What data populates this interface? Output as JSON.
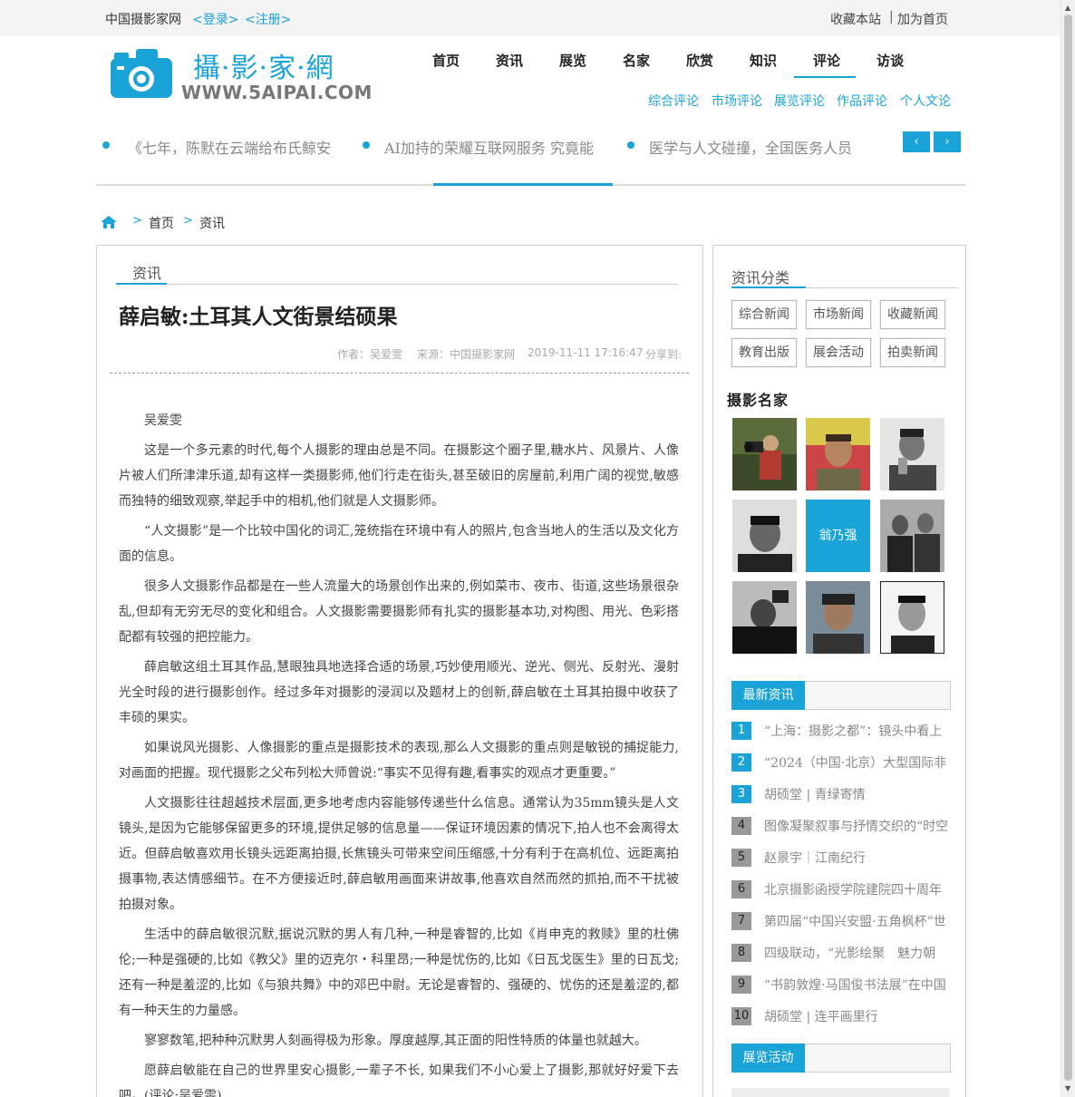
{
  "topbar": {
    "site_name": "中国摄影家网",
    "login": "<登录>",
    "register": "<注册>",
    "bookmark": "收藏本站",
    "separator": "|",
    "set_home": "加为首页"
  },
  "logo": {
    "title": "攝·影·家·網",
    "url": "WWW.5AIPAI.COM",
    "icon": "camera-icon"
  },
  "nav": {
    "items": [
      "首页",
      "资讯",
      "展览",
      "名家",
      "欣赏",
      "知识",
      "评论",
      "访谈"
    ],
    "active": "评论",
    "subnav": [
      "综合评论",
      "市场评论",
      "展览评论",
      "作品评论",
      "个人文论"
    ]
  },
  "ticker": {
    "items": [
      "《七年，陈默在云端给布氏鲸安",
      "AI加持的荣耀互联网服务 究竟能",
      "医学与人文碰撞，全国医务人员"
    ],
    "prev": "‹",
    "next": "›"
  },
  "breadcrumb": {
    "icon": "home-icon",
    "arrow": ">",
    "items": [
      "首页",
      "资讯"
    ]
  },
  "article": {
    "section": "资讯",
    "title": "薛启敏:土耳其人文街景结硕果",
    "author": "作者：吴爱雯",
    "source": "来源：中国摄影家网",
    "date": "2019-11-11 17:16:47",
    "share": "分享到:",
    "paragraphs": [
      "吴爱雯",
      "这是一个多元素的时代,每个人摄影的理由总是不同。在摄影这个圈子里,糖水片、风景片、人像片被人们所津津乐道,却有这样一类摄影师,他们行走在街头,甚至破旧的房屋前,利用广阔的视觉,敏感而独特的细致观察,举起手中的相机,他们就是人文摄影师。",
      "“人文摄影”是一个比较中国化的词汇,笼统指在环境中有人的照片,包含当地人的生活以及文化方面的信息。",
      "很多人文摄影作品都是在一些人流量大的场景创作出来的,例如菜市、夜市、街道,这些场景很杂乱,但却有无穷无尽的变化和组合。人文摄影需要摄影师有扎实的摄影基本功,对构图、用光、色彩搭配都有较强的把控能力。",
      "薛启敏这组土耳其作品,慧眼独具地选择合适的场景,巧妙使用顺光、逆光、侧光、反射光、漫射光全时段的进行摄影创作。经过多年对摄影的浸润以及题材上的创新,薛启敏在土耳其拍摄中收获了丰硕的果实。",
      "如果说风光摄影、人像摄影的重点是摄影技术的表现,那么人文摄影的重点则是敏锐的捕捉能力,对画面的把握。现代摄影之父布列松大师曾说:“事实不见得有趣,看事实的观点才更重要。”",
      "人文摄影往往超越技术层面,更多地考虑内容能够传递些什么信息。通常认为35mm镜头是人文镜头,是因为它能够保留更多的环境,提供足够的信息量——保证环境因素的情况下,拍人也不会离得太近。但薛启敏喜欢用长镜头远距离拍摄,长焦镜头可带来空间压缩感,十分有利于在高机位、远距离拍摄事物,表达情感细节。在不方便接近时,薛启敏用画面来讲故事,他喜欢自然而然的抓拍,而不干扰被拍摄对象。",
      "生活中的薛启敏很沉默,据说沉默的男人有几种,一种是睿智的,比如《肖申克的救赎》里的杜佛伦;一种是强硬的,比如《教父》里的迈克尔・科里昂;一种是忧伤的,比如《日瓦戈医生》里的日瓦戈;还有一种是羞涩的,比如《与狼共舞》中的邓巴中尉。无论是睿智的、强硬的、忧伤的还是羞涩的,都有一种天生的力量感。",
      "寥寥数笔,把种种沉默男人刻画得极为形象。厚度越厚,其正面的阳性特质的体量也就越大。",
      "愿薛启敏能在自己的世界里安心摄影,一辈子不长, 如果我们不小心爱上了摄影,那就好好爱下去吧。(评论:吴爱雯)"
    ]
  },
  "sidebar": {
    "category_title": "资讯分类",
    "categories": [
      "综合新闻",
      "市场新闻",
      "收藏新闻",
      "教育出版",
      "展会活动",
      "拍卖新闻"
    ],
    "photographers_title": "摄影名家",
    "highlight_name": "翁乃强",
    "latest_title": "最新资讯",
    "latest": [
      {
        "num": "1",
        "text": "“上海：摄影之都”：镜头中看上"
      },
      {
        "num": "2",
        "text": "“2024（中国·北京）大型国际非"
      },
      {
        "num": "3",
        "text": "胡硕堂 | 青绿寄情"
      },
      {
        "num": "4",
        "text": "图像凝聚叙事与抒情交织的“时空"
      },
      {
        "num": "5",
        "text": "赵景宇｜江南纪行"
      },
      {
        "num": "6",
        "text": "北京摄影函授学院建院四十周年"
      },
      {
        "num": "7",
        "text": "第四届“中国兴安盟·五角枫杯”世"
      },
      {
        "num": "8",
        "text": "四级联动，“光影绘聚　魅力朝"
      },
      {
        "num": "9",
        "text": "“书韵敦煌·马国俊书法展”在中国"
      },
      {
        "num": "10",
        "text": "胡硕堂 | 连平画里行"
      }
    ],
    "exhibition_title": "展览活动"
  },
  "colors": {
    "accent": "#1aa3d6",
    "grey_badge": "#999999"
  }
}
